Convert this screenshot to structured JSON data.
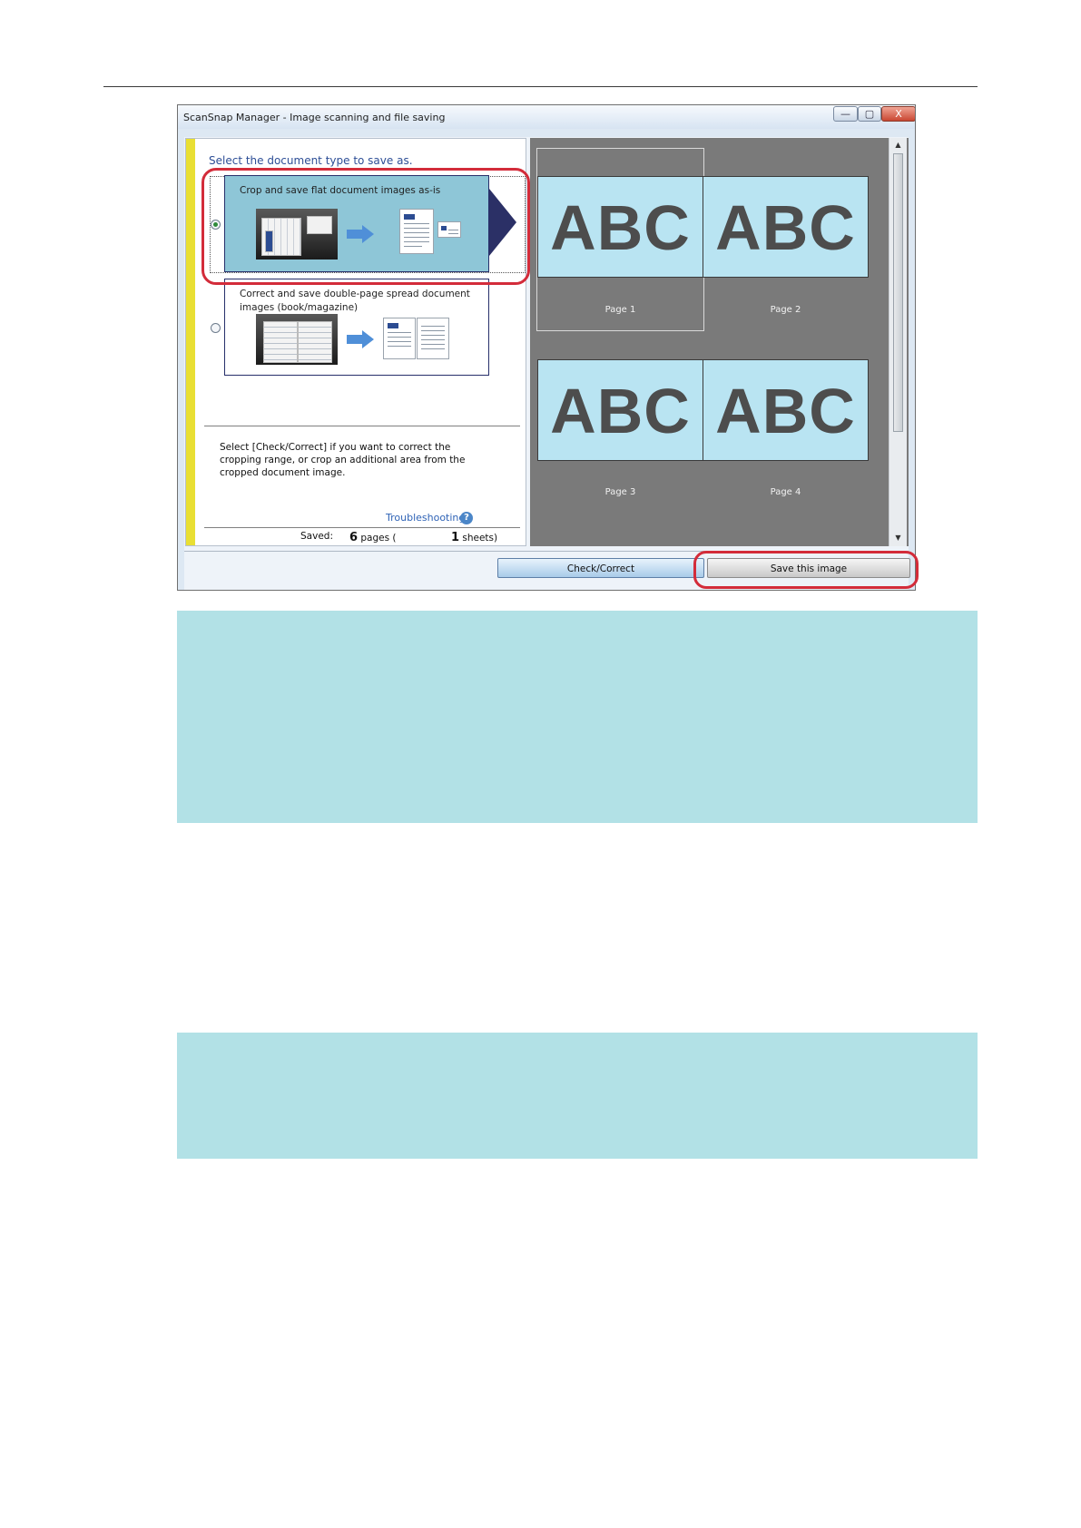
{
  "window": {
    "title": "ScanSnap Manager - Image scanning and file saving",
    "controls": {
      "minimize": "—",
      "maximize": "▢",
      "close": "X"
    }
  },
  "left_panel": {
    "prompt": "Select the document type to save as.",
    "options": [
      {
        "label": "Crop and save flat document images as-is",
        "selected": true
      },
      {
        "label": "Correct and save double-page spread document images (book/magazine)",
        "selected": false
      }
    ],
    "info_text": "Select [Check/Correct] if you want to correct the cropping range, or crop an additional area from the cropped document image.",
    "troubleshooting_link": "Troubleshooting",
    "help_icon": "?",
    "saved": {
      "label": "Saved:",
      "pages_count": "6",
      "pages_label": "pages (",
      "sheets_count": "1",
      "sheets_label": "sheets)"
    }
  },
  "preview": {
    "pages": [
      {
        "thumb_text": "ABC",
        "label": "Page 1",
        "selected": true
      },
      {
        "thumb_text": "ABC",
        "label": "Page 2",
        "selected": false
      },
      {
        "thumb_text": "ABC",
        "label": "Page 3",
        "selected": false
      },
      {
        "thumb_text": "ABC",
        "label": "Page 4",
        "selected": false
      }
    ],
    "scroll_up": "▲",
    "scroll_down": "▼"
  },
  "buttons": {
    "check_correct": "Check/Correct",
    "save_image": "Save this image"
  },
  "colors": {
    "highlight": "#d32c3a",
    "selected_option": "#8ec6d7",
    "note_background": "#b2e1e6",
    "thumbnail": "#b9e4f2"
  }
}
